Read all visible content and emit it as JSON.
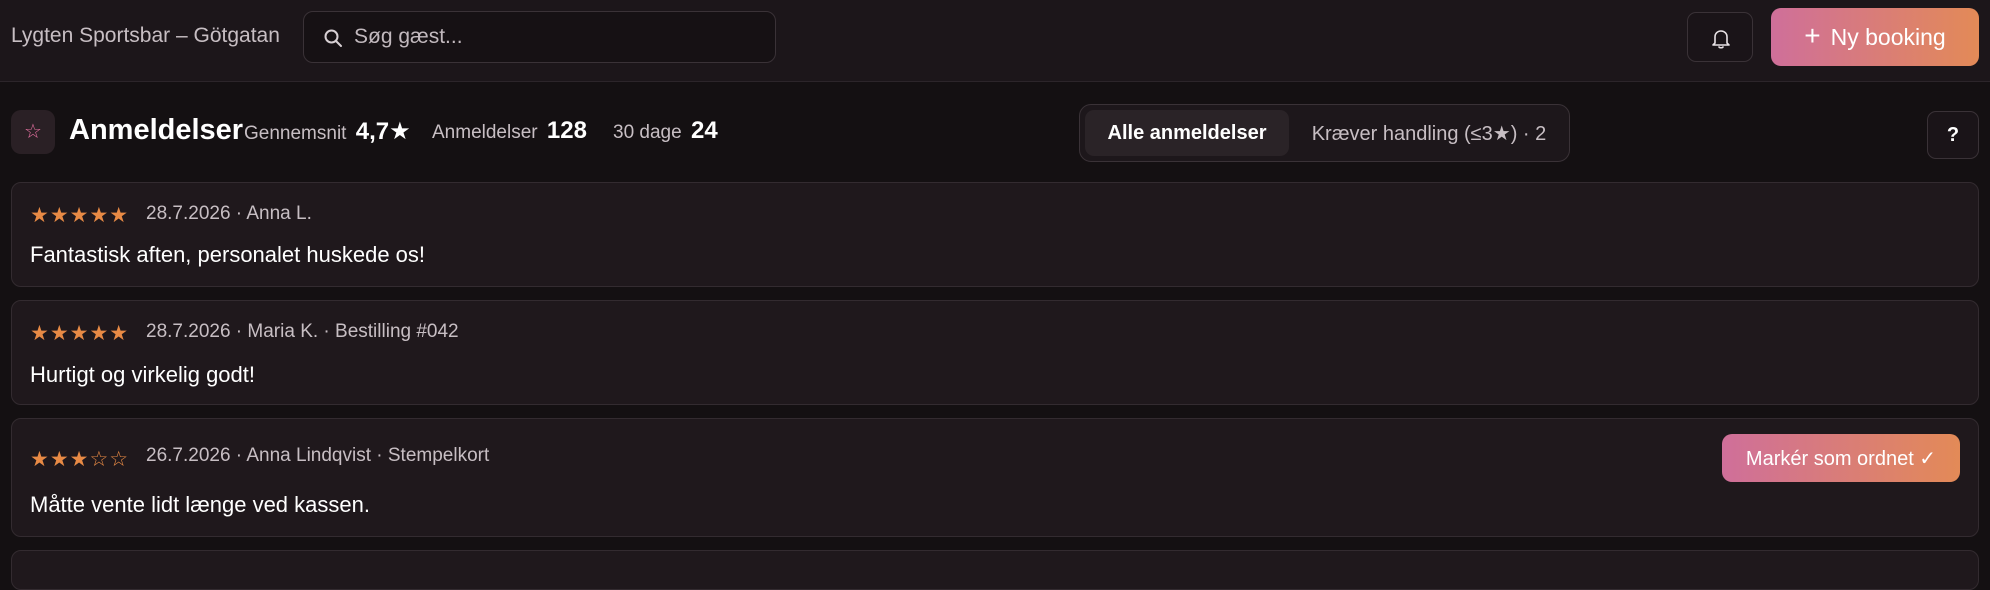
{
  "header": {
    "venue_name": "Lygten Sportsbar – Götgatan",
    "search": {
      "placeholder": "Søg gæst...",
      "value": ""
    },
    "notifications_icon": "bell-icon",
    "new_booking": {
      "icon": "plus",
      "label": "Ny booking"
    }
  },
  "reviews_page": {
    "title": "Anmeldelser",
    "title_icon": "star-icon",
    "stats": {
      "average": {
        "label": "Gennemsnit",
        "value": "4,7★"
      },
      "count": {
        "label": "Anmeldelser",
        "value": "128"
      },
      "last_30": {
        "label": "30 dage",
        "value": "24"
      }
    },
    "filter": {
      "selected": "Alle anmeldelser",
      "options": [
        "Alle anmeldelser",
        "Kræver handling (≤3★) · 2"
      ]
    },
    "help_label": "?"
  },
  "reviews": [
    {
      "rating": 5,
      "stars_text": "★★★★★",
      "meta": "28.7.2026 · Anna L.",
      "text": "Fantastisk aften, personalet huskede os!"
    },
    {
      "rating": 5,
      "stars_text": "★★★★★",
      "meta": "28.7.2026 · Maria K. · Bestilling #042",
      "text": "Hurtigt og virkelig godt!"
    },
    {
      "rating": 3,
      "stars_text": "★★★☆☆",
      "meta": "26.7.2026 · Anna Lindqvist · Stempelkort",
      "text": "Måtte vente lidt længe ved kassen.",
      "action_label": "Markér som ordnet ✓"
    }
  ],
  "colors": {
    "accent_start": "#cf6f9a",
    "accent_end": "#e38a57",
    "star": "#e88a45",
    "background": "#141012",
    "card": "#1f181c"
  }
}
